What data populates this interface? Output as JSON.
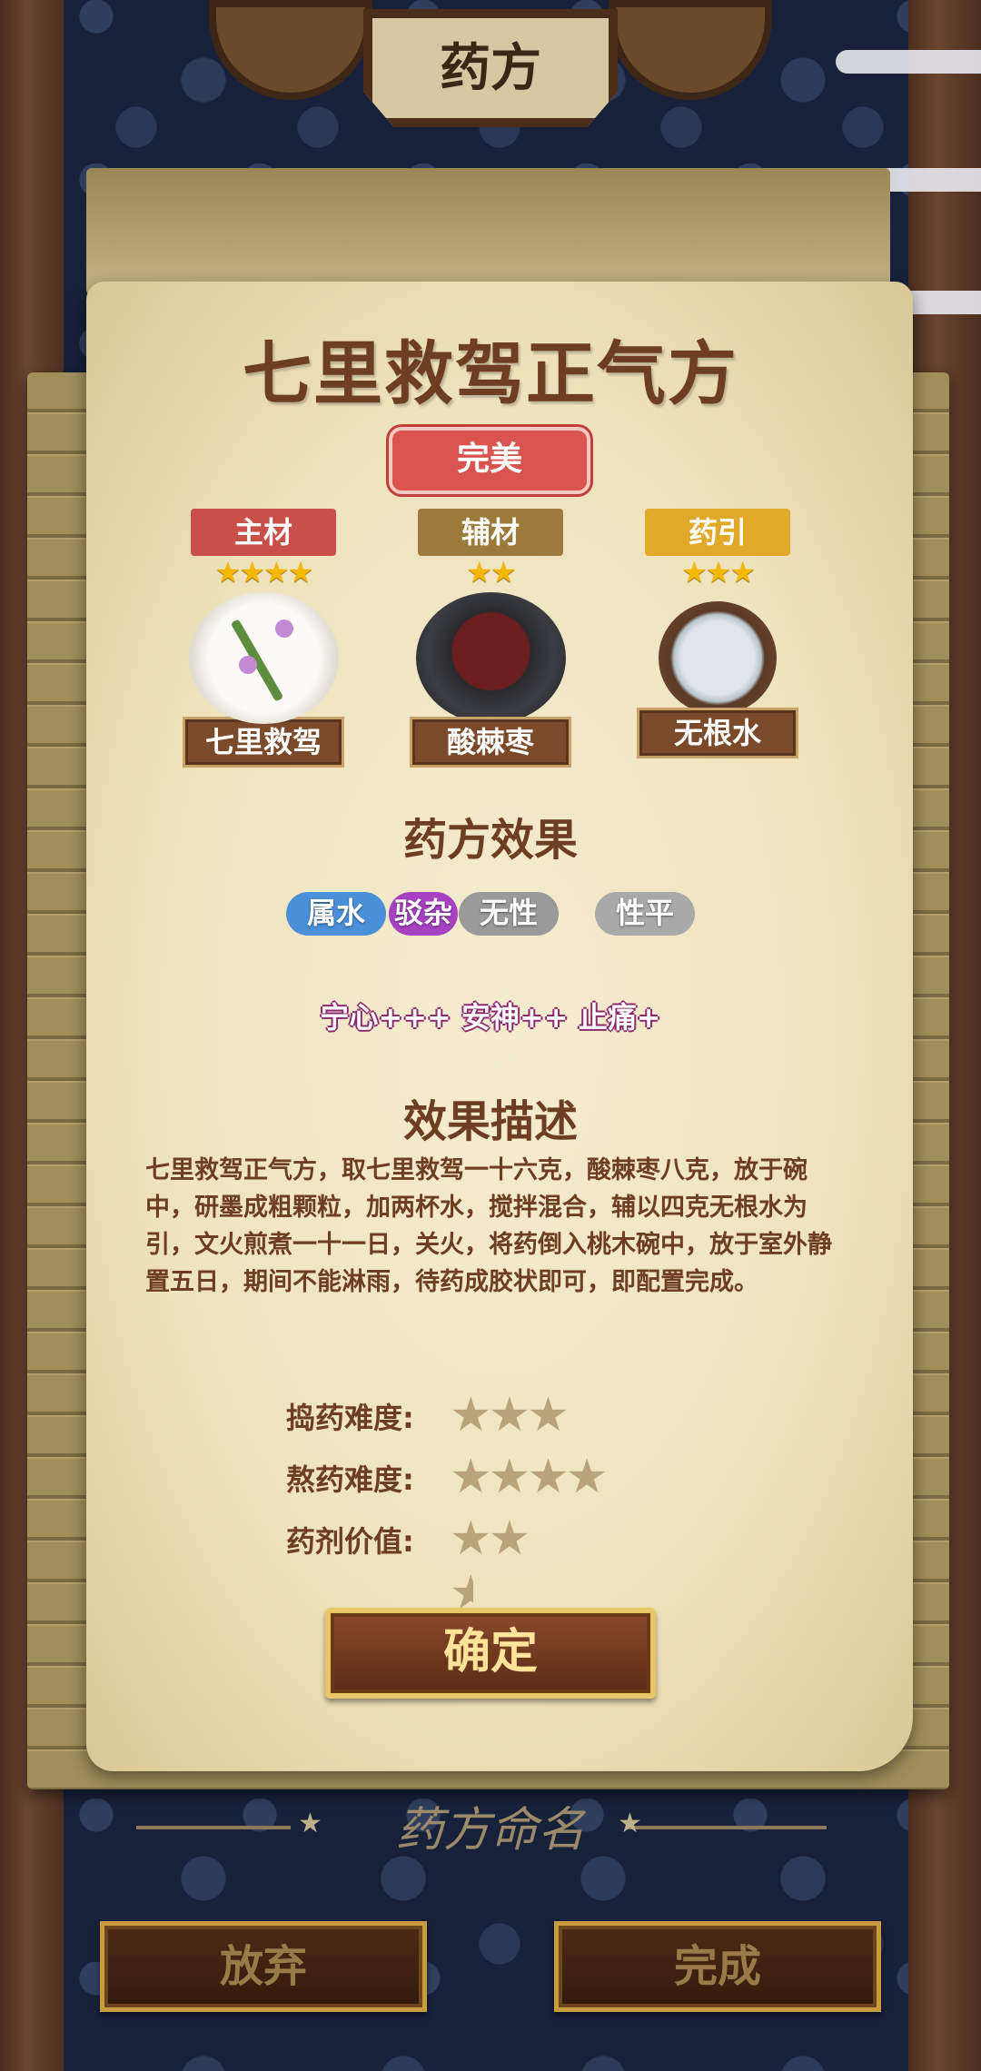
{
  "header": {
    "title": "药方"
  },
  "recipe": {
    "name": "七里救驾正气方",
    "rating": "完美",
    "ingredients": [
      {
        "role": "主材",
        "role_color": "#c9504a",
        "stars": 4,
        "name": "七里救驾"
      },
      {
        "role": "辅材",
        "role_color": "#9c7a3a",
        "stars": 2,
        "name": "酸棘枣"
      },
      {
        "role": "药引",
        "role_color": "#e0a92a",
        "stars": 3,
        "name": "无根水"
      }
    ]
  },
  "effects_section": {
    "title": "药方效果",
    "properties": [
      {
        "label": "属水",
        "color": "#4a90d9"
      },
      {
        "label": "驳杂",
        "color": "#a642c2"
      },
      {
        "label": "无性",
        "color": "#9a9a9a"
      },
      {
        "label": "性平",
        "color": "#a9a9a9"
      }
    ],
    "effects_text": "宁心+++ 安神++ 止痛+"
  },
  "description_section": {
    "title": "效果描述",
    "text": "七里救驾正气方，取七里救驾一十六克，酸棘枣八克，放于碗中，研墨成粗颗粒，加两杯水，搅拌混合，辅以四克无根水为引，文火煎煮一十一日，关火，将药倒入桃木碗中，放于室外静置五日，期间不能淋雨，待药成胶状即可，即配置完成。"
  },
  "stats": [
    {
      "label": "捣药难度:",
      "stars": 3
    },
    {
      "label": "熬药难度:",
      "stars": 4
    },
    {
      "label": "药剂价值:",
      "stars": 2.5
    }
  ],
  "confirm_label": "确定",
  "rename": {
    "label": "药方命名"
  },
  "buttons": {
    "abandon": "放弃",
    "finish": "完成"
  }
}
